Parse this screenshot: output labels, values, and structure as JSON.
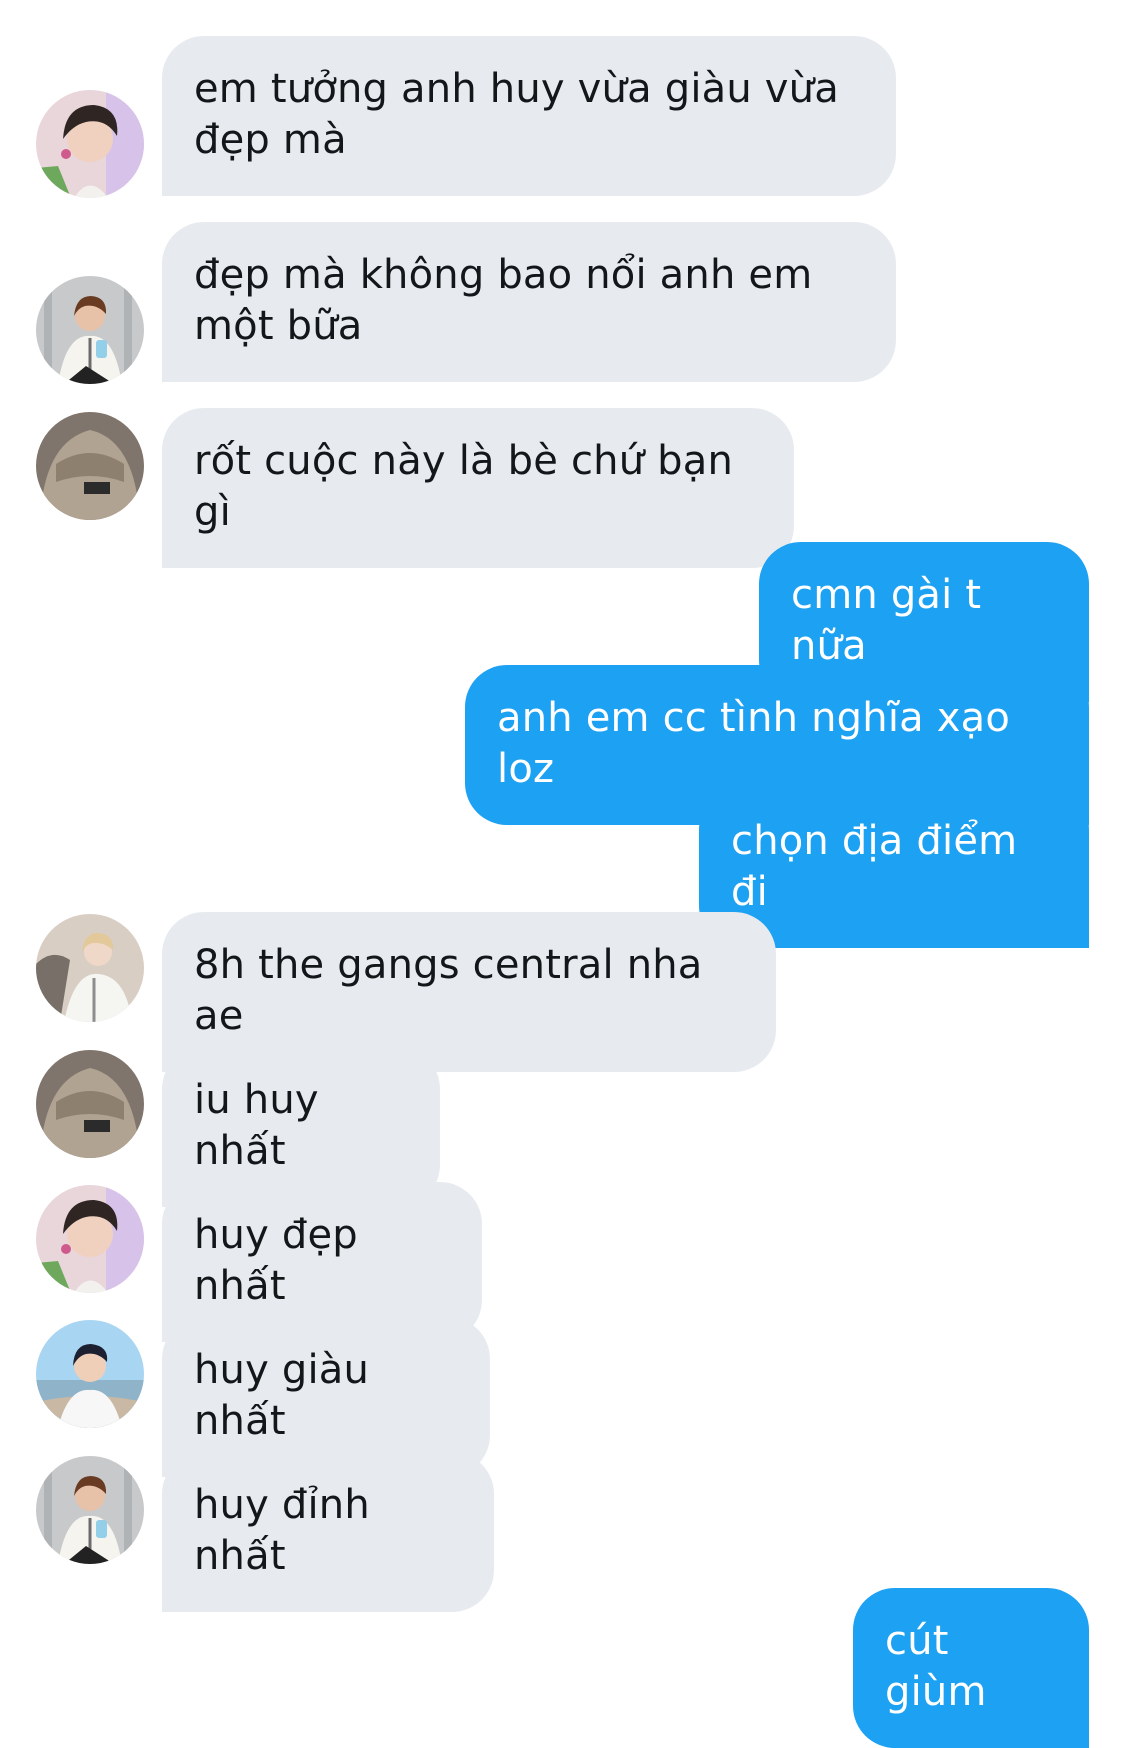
{
  "conversation": {
    "messages": [
      {
        "side": "incoming",
        "avatar": "avatar-boy-pink-bg",
        "text": "em tưởng anh huy vừa giàu vừa đẹp mà"
      },
      {
        "side": "incoming",
        "avatar": "avatar-boy-seated-gray-bg",
        "text": "đẹp mà không bao nổi anh em một bữa"
      },
      {
        "side": "incoming",
        "avatar": "avatar-hoodie-brown",
        "text": "rốt cuộc này là bè chứ bạn gì"
      },
      {
        "side": "outgoing",
        "text": "cmn gài t nữa"
      },
      {
        "side": "outgoing",
        "text": "anh em cc tình nghĩa xạo loz"
      },
      {
        "side": "outgoing",
        "text": "chọn địa điểm đi"
      },
      {
        "side": "incoming",
        "avatar": "avatar-blond-white-jacket",
        "text": "8h the gangs central nha ae"
      },
      {
        "side": "incoming",
        "avatar": "avatar-hoodie-brown",
        "text": "iu huy nhất"
      },
      {
        "side": "incoming",
        "avatar": "avatar-boy-pink-bg",
        "text": "huy đẹp nhất"
      },
      {
        "side": "incoming",
        "avatar": "avatar-boy-beach-blue-sky",
        "text": "huy giàu nhất"
      },
      {
        "side": "incoming",
        "avatar": "avatar-boy-seated-gray-bg",
        "text": "huy đỉnh nhất"
      },
      {
        "side": "outgoing",
        "text": "cút giùm"
      }
    ]
  },
  "colors": {
    "incoming_bubble": "#e7ebef",
    "incoming_text": "#14171a",
    "outgoing_bubble": "#1da1f2",
    "outgoing_text": "#ffffff",
    "background": "#ffffff"
  }
}
